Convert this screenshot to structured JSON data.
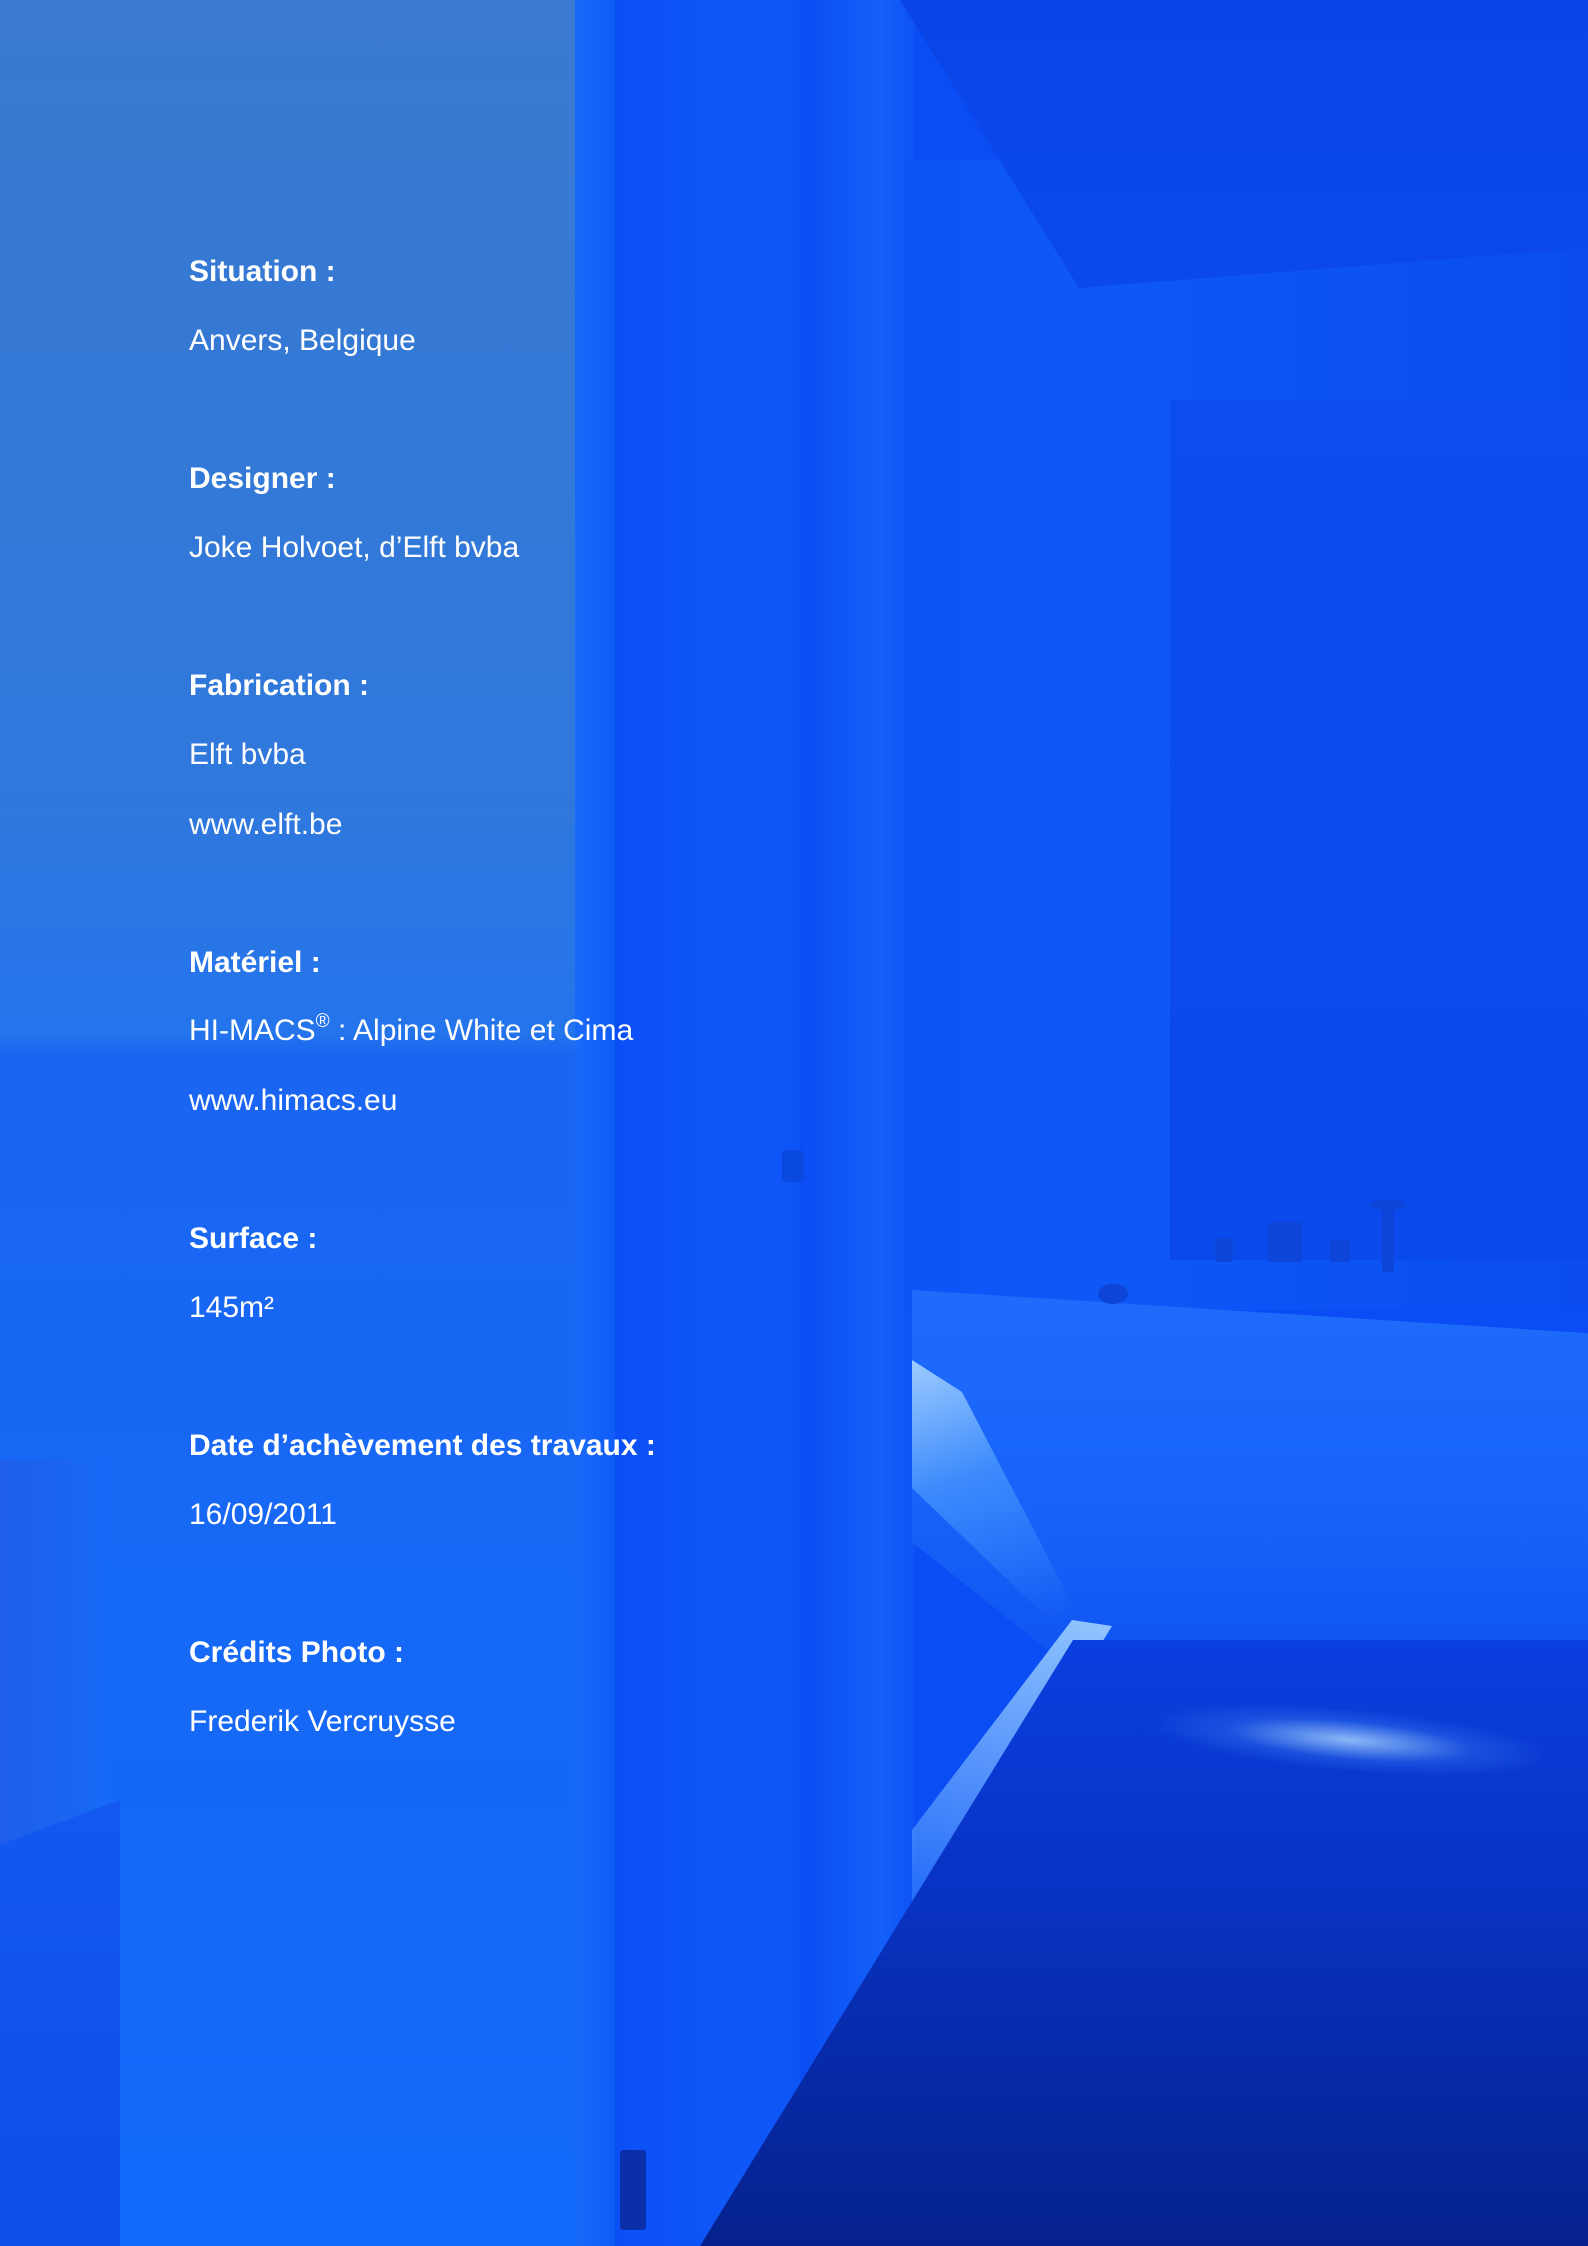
{
  "sections": [
    {
      "label": "Situation :",
      "values": [
        "Anvers, Belgique"
      ]
    },
    {
      "label": "Designer :",
      "values": [
        "Joke Holvoet, d’Elft bvba"
      ]
    },
    {
      "label": "Fabrication :",
      "values": [
        "Elft bvba",
        "www.elft.be"
      ]
    },
    {
      "label": "Matériel :",
      "values": [
        "HI-MACS",
        "®",
        " : Alpine White et Cima",
        "www.himacs.eu"
      ]
    },
    {
      "label": "Surface :",
      "values": [
        "145m²"
      ]
    },
    {
      "label": "Date d’achèvement des travaux :",
      "values": [
        "16/09/2011"
      ]
    },
    {
      "label": "Crédits Photo :",
      "values": [
        "Frederik Vercruysse"
      ]
    }
  ]
}
